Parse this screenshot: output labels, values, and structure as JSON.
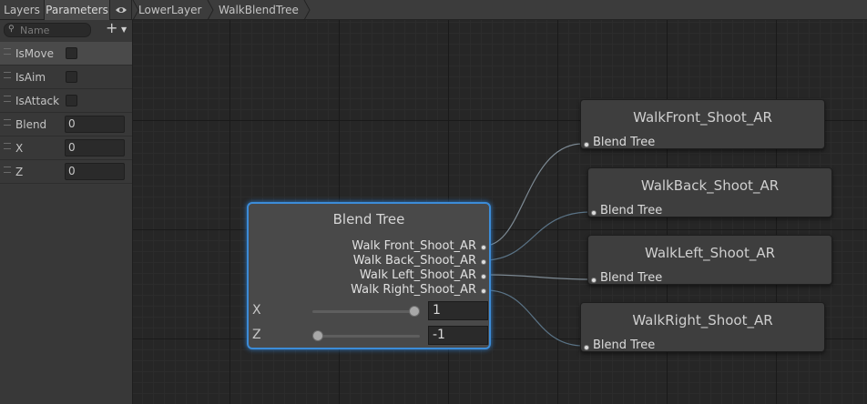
{
  "tabs": {
    "layers": "Layers",
    "parameters": "Parameters"
  },
  "breadcrumb": [
    "LowerLayer",
    "WalkBlendTree"
  ],
  "search": {
    "placeholder": "Name"
  },
  "parameters": [
    {
      "name": "IsMove",
      "type": "bool"
    },
    {
      "name": "IsAim",
      "type": "bool"
    },
    {
      "name": "IsAttack",
      "type": "bool"
    },
    {
      "name": "Blend",
      "type": "float",
      "value": "0"
    },
    {
      "name": "X",
      "type": "float",
      "value": "0"
    },
    {
      "name": "Z",
      "type": "float",
      "value": "0"
    }
  ],
  "blend_tree": {
    "title": "Blend Tree",
    "outputs": [
      "Walk Front_Shoot_AR",
      "Walk Back_Shoot_AR",
      "Walk Left_Shoot_AR",
      "Walk Right_Shoot_AR"
    ],
    "x": {
      "label": "X",
      "value": "1",
      "level": 1.0
    },
    "z": {
      "label": "Z",
      "value": "-1",
      "level": 0.0
    }
  },
  "motion_nodes": [
    {
      "title": "WalkFront_Shoot_AR",
      "sub": "Blend Tree"
    },
    {
      "title": "WalkBack_Shoot_AR",
      "sub": "Blend Tree"
    },
    {
      "title": "WalkLeft_Shoot_AR",
      "sub": "Blend Tree"
    },
    {
      "title": "WalkRight_Shoot_AR",
      "sub": "Blend Tree"
    }
  ],
  "colors": {
    "selection": "#3c8cd8",
    "wire": "#7a8a96"
  },
  "icons": {
    "eye": "eye-icon",
    "search": "search-icon",
    "add": "plus-icon"
  }
}
